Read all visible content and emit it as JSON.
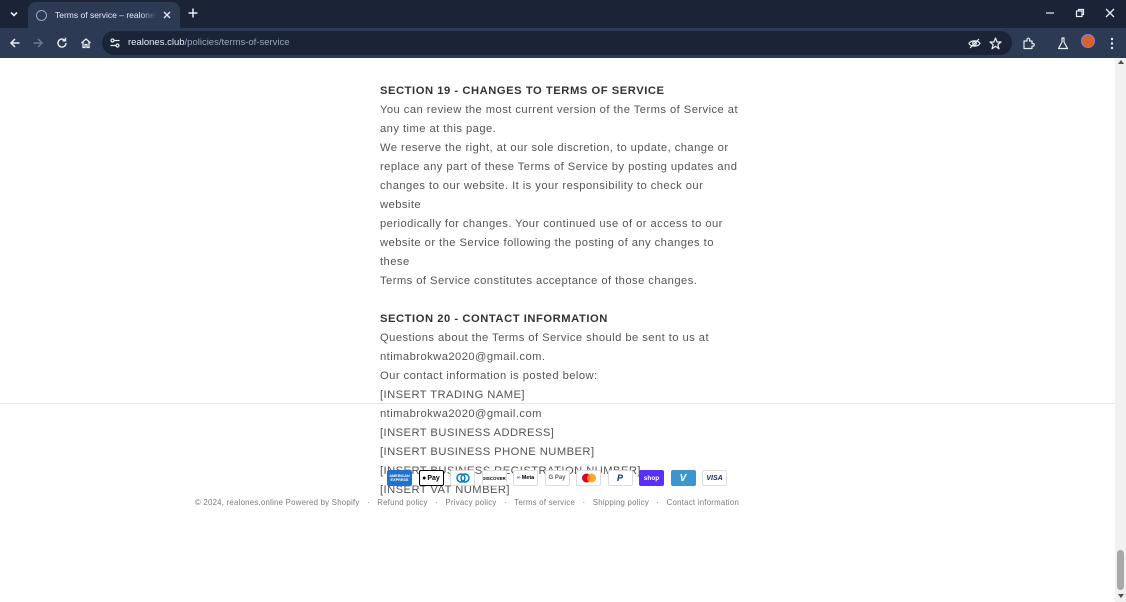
{
  "browser": {
    "tab_title": "Terms of service – realones.online",
    "url_domain": "realones.club",
    "url_path": "/policies/terms-of-service"
  },
  "policy": {
    "section19": {
      "heading": "SECTION 19 - CHANGES TO TERMS OF SERVICE",
      "line1": "You can review the most current version of the Terms of Service at",
      "line2": "any time at this page.",
      "line3": "We reserve the right, at our sole discretion, to update, change or",
      "line4": "replace any part of these Terms of Service by posting updates and",
      "line5": "changes to our website. It is your responsibility to check our website",
      "line6": "periodically for changes. Your continued use of or access to our",
      "line7": "website or the Service following the posting of any changes to these",
      "line8": "Terms of Service constitutes acceptance of those changes."
    },
    "section20": {
      "heading": "SECTION 20 - CONTACT INFORMATION",
      "line1": "Questions about the Terms of Service should be sent to us at",
      "line2": "ntimabrokwa2020@gmail.com.",
      "line3": "Our contact information is posted below:",
      "line4": "[INSERT TRADING NAME]",
      "line5": "ntimabrokwa2020@gmail.com",
      "line6": "[INSERT BUSINESS ADDRESS]",
      "line7": "[INSERT BUSINESS PHONE NUMBER]",
      "line8": "[INSERT BUSINESS REGISTRATION NUMBER]",
      "line9": "[INSERT VAT NUMBER]"
    }
  },
  "payments": {
    "amex": "AMERICAN EXPRESS",
    "applepay": "Pay",
    "discover": "DISCOVER",
    "meta": "Meta",
    "gpay": "G Pay",
    "shoppay": "shop",
    "visa": "VISA"
  },
  "footer": {
    "copyright": "© 2024, realones.online",
    "powered": "Powered by Shopify",
    "links": [
      "Refund policy",
      "Privacy policy",
      "Terms of service",
      "Shipping policy",
      "Contact information"
    ]
  }
}
